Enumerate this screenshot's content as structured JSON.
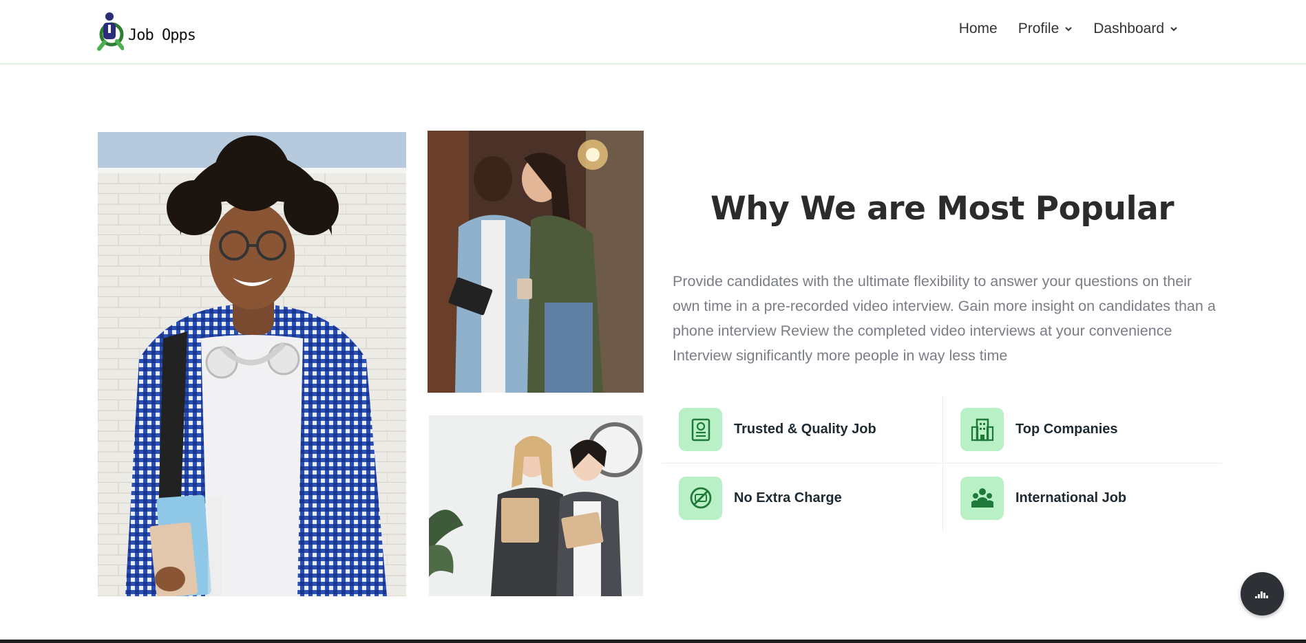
{
  "header": {
    "logo_text": "Job Opps",
    "nav": [
      {
        "label": "Home",
        "has_dropdown": false
      },
      {
        "label": "Profile",
        "has_dropdown": true
      },
      {
        "label": "Dashboard",
        "has_dropdown": true
      }
    ]
  },
  "section": {
    "title": "Why We are Most Popular",
    "description": "Provide candidates with the ultimate flexibility to answer your questions on their own time in a pre-recorded video interview. Gain more insight on candidates than a phone interview Review the completed video interviews at your convenience Interview significantly more people in way less time",
    "features": [
      {
        "label": "Trusted & Quality Job",
        "icon": "certificate-icon"
      },
      {
        "label": "Top Companies",
        "icon": "building-icon"
      },
      {
        "label": "No Extra Charge",
        "icon": "no-charge-icon"
      },
      {
        "label": "International Job",
        "icon": "team-icon"
      }
    ]
  },
  "images": {
    "main": "student-with-headphones-photo",
    "top": "colleagues-with-tablet-photo",
    "bottom": "businesswomen-with-folders-photo"
  },
  "colors": {
    "accent": "#b9f0c5",
    "icon_green": "#1f7a3a",
    "text_dark": "#2b2b2b",
    "text_muted": "#7a7d87",
    "fab": "#2d3136"
  },
  "fab_icon": "chart-icon"
}
